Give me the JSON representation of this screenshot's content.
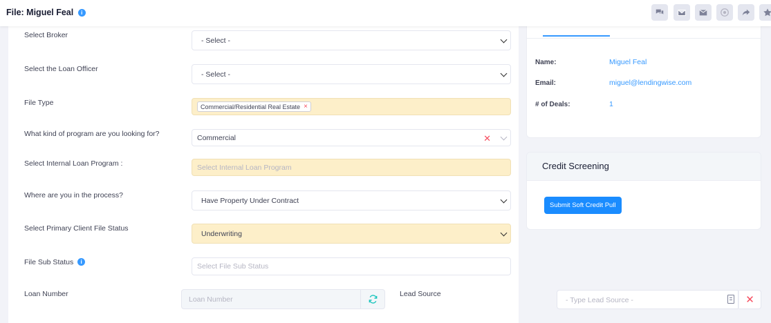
{
  "header": {
    "title": "File: Miguel Feal",
    "info_glyph": "i",
    "actions": [
      "chat-icon",
      "envelope-icon",
      "envelope-open-icon",
      "target-icon",
      "share-icon",
      "star-icon"
    ]
  },
  "form": {
    "broker": {
      "label": "Select Broker",
      "value": "- Select -"
    },
    "loan_officer": {
      "label": "Select the Loan Officer",
      "value": "- Select -"
    },
    "file_type": {
      "label": "File Type",
      "tag": "Commercial/Residential Real Estate",
      "tag_remove": "×"
    },
    "program": {
      "label": "What kind of program are you looking for?",
      "value": "Commercial",
      "clear": "✕"
    },
    "internal_program": {
      "label": "Select Internal Loan Program :",
      "placeholder": "Select Internal Loan Program"
    },
    "process": {
      "label": "Where are you in the process?",
      "value": "Have Property Under Contract"
    },
    "client_status": {
      "label": "Select Primary Client File Status",
      "value": "Underwriting"
    },
    "sub_status": {
      "label": "File Sub Status",
      "info_glyph": "i",
      "placeholder": "Select File Sub Status"
    },
    "loan_number": {
      "label": "Loan Number",
      "placeholder": "Loan Number"
    },
    "lead_source": {
      "label": "Lead Source",
      "placeholder": "- Type Lead Source -",
      "clear": "✕"
    }
  },
  "borrower": {
    "name_label": "Name:",
    "name": "Miguel Feal",
    "email_label": "Email:",
    "email": "miguel@lendingwise.com",
    "deals_label": "# of Deals:",
    "deals": "1"
  },
  "credit": {
    "title": "Credit Screening",
    "button": "Submit Soft Credit Pull"
  },
  "colors": {
    "accent": "#3699ff",
    "highlight": "#fdefc9",
    "danger": "#f64e60"
  }
}
